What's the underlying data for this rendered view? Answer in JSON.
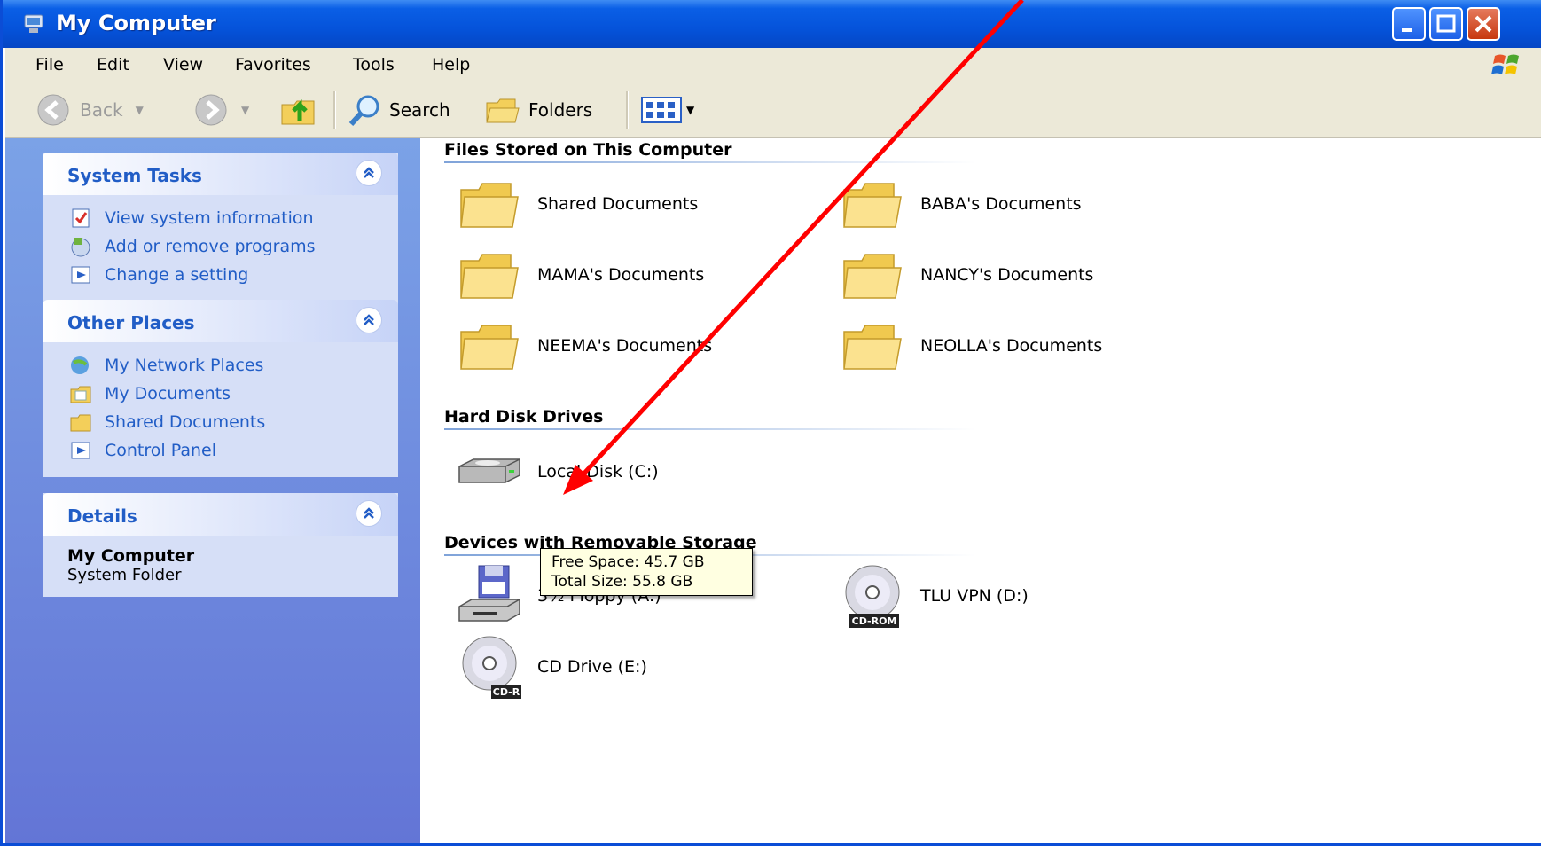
{
  "window": {
    "title": "My Computer"
  },
  "menu": {
    "items": [
      "File",
      "Edit",
      "View",
      "Favorites",
      "Tools",
      "Help"
    ],
    "underline": [
      "F",
      "E",
      "V",
      "a",
      "T",
      "H"
    ]
  },
  "toolbar": {
    "back_label": "Back",
    "search_label": "Search",
    "folders_label": "Folders"
  },
  "sidebar": {
    "system_tasks": {
      "title": "System Tasks",
      "items": [
        "View system information",
        "Add or remove programs",
        "Change a setting"
      ]
    },
    "other_places": {
      "title": "Other Places",
      "items": [
        "My Network Places",
        "My Documents",
        "Shared Documents",
        "Control Panel"
      ]
    },
    "details": {
      "title": "Details",
      "name": "My Computer",
      "type": "System Folder"
    }
  },
  "content": {
    "groups": {
      "files": {
        "title": "Files Stored on This Computer"
      },
      "drives": {
        "title": "Hard Disk Drives"
      },
      "devices": {
        "title": "Devices with Removable Storage"
      }
    },
    "folders": [
      "Shared Documents",
      "BABA's Documents",
      "MAMA's Documents",
      "NANCY's Documents",
      "NEEMA's Documents",
      "NEOLLA's Documents"
    ],
    "hard_disks": [
      "Local Disk (C:)"
    ],
    "removable": [
      "3½ Floppy (A:)",
      "TLU VPN (D:)",
      "CD Drive (E:)"
    ],
    "disc_badges": {
      "cdrom": "CD-ROM",
      "cdr": "CD-R"
    }
  },
  "tooltip": {
    "free_space": "Free Space: 45.7 GB",
    "total_size": "Total Size: 55.8 GB"
  },
  "colors": {
    "title_blue": "#0553da",
    "task_link": "#215dc6",
    "annotation_arrow": "#ff0000"
  }
}
